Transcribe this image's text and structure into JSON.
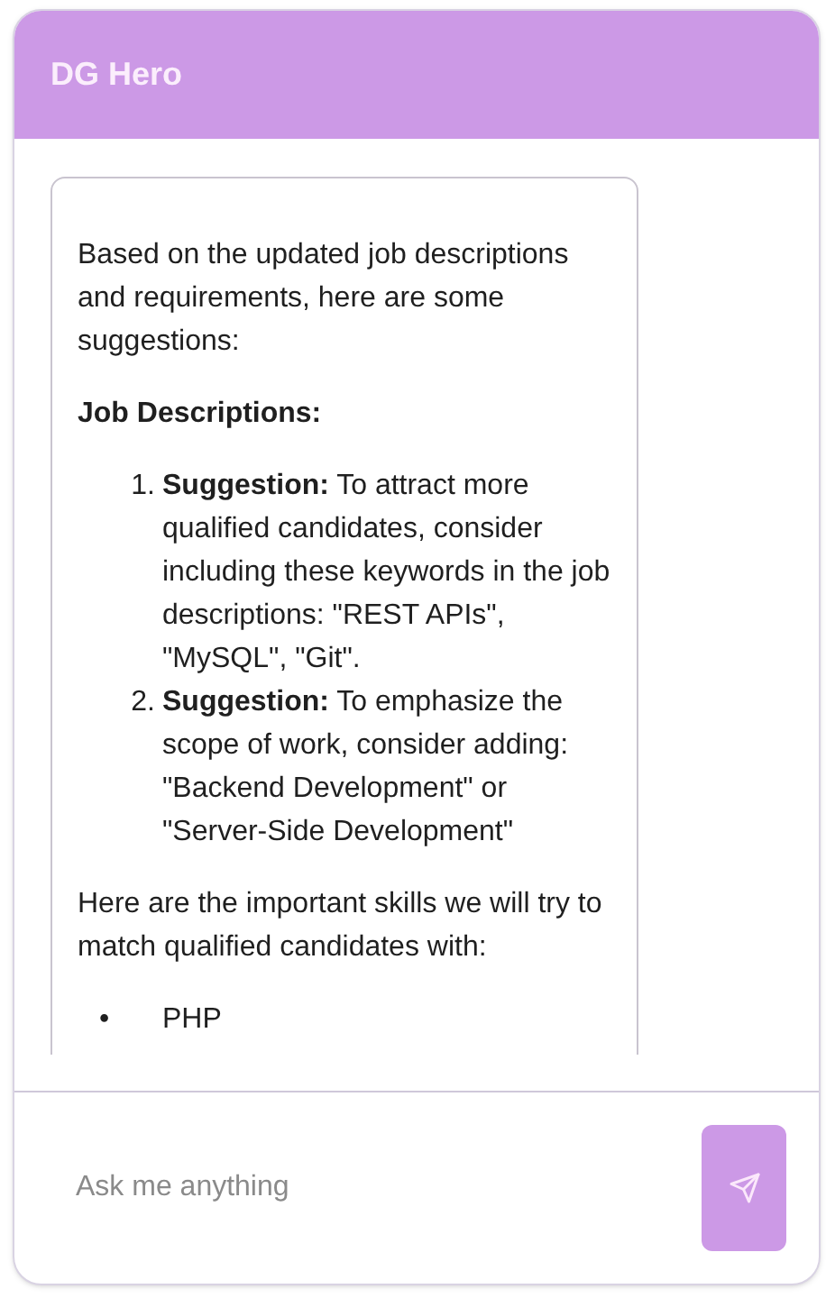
{
  "header": {
    "title": "DG Hero"
  },
  "messages": [
    {
      "blocks": [
        {
          "kind": "paragraph",
          "text": "Based on the updated job descriptions and requirements, here are some suggestions:"
        },
        {
          "kind": "heading",
          "text": "Job Descriptions:"
        },
        {
          "kind": "ordered_list",
          "items": [
            {
              "marker": "1.",
              "text": "**Suggestion:** To attract more qualified candidates, consider including these keywords in the job descriptions: \"REST APIs\", \"MySQL\", \"Git\"."
            },
            {
              "marker": "2.",
              "text": "**Suggestion:** To emphasize the scope of work, consider adding: \"Backend Development\" or \"Server-Side Development\""
            }
          ]
        },
        {
          "kind": "paragraph",
          "text": "Here are the important skills we will try to match qualified candidates with:"
        },
        {
          "kind": "bullet_list",
          "items": [
            {
              "marker": "•",
              "text": "PHP"
            }
          ]
        }
      ]
    }
  ],
  "composer": {
    "placeholder": "Ask me anything"
  }
}
